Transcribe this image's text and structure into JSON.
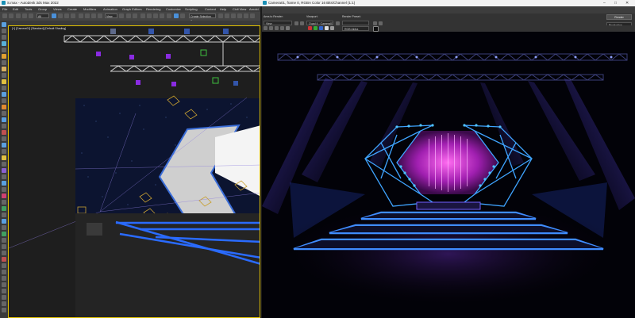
{
  "app": {
    "title": "S.max - Autodesk 3ds Max 2022"
  },
  "menu": [
    "File",
    "Edit",
    "Tools",
    "Group",
    "Views",
    "Create",
    "Modifiers",
    "Animation",
    "Graph Editors",
    "Rendering",
    "Customize",
    "Scripting",
    "Content",
    "Help",
    "Civil View",
    "Arnold"
  ],
  "toolbar": {
    "selection_filter": "All",
    "reference_coord": "View",
    "named_selection": "Create Selection Se"
  },
  "viewport": {
    "label": "[+] [Camera01] [Standard] [Default Shading]"
  },
  "frame_buffer": {
    "title": "Camera01, frame 0, RGBA Color 16 Bits/Channel (1:1)",
    "area_to_render_label": "Area to Render:",
    "area_to_render_value": "View",
    "viewport_label": "Viewport:",
    "viewport_value": "Quad 4 - Camera01",
    "render_preset_label": "Render Preset:",
    "render_preset_value": "",
    "render_button": "Render",
    "mode_value": "Production",
    "render_type_value": "RGB Alpha"
  },
  "colors": {
    "accent_blue": "#4a90d9",
    "stage_blue": "#2f6cff",
    "magenta": "#d63cff"
  }
}
